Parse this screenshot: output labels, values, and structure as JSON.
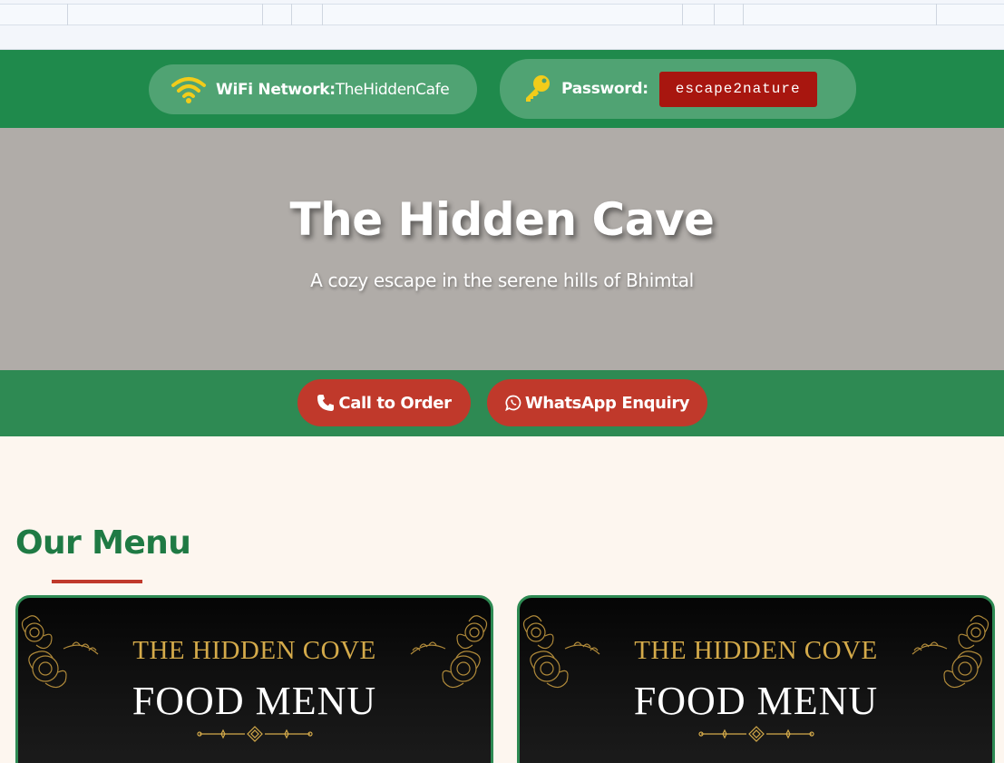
{
  "wifi": {
    "network_label": "WiFi Network:",
    "network_value": "TheHiddenCafe",
    "password_label": "Password:",
    "password_value": "escape2nature"
  },
  "hero": {
    "title": "The Hidden Cave",
    "subtitle": "A cozy escape in the serene hills of Bhimtal"
  },
  "actions": {
    "call_label": "Call to Order",
    "whatsapp_label": "WhatsApp Enquiry"
  },
  "menu": {
    "heading": "Our Menu",
    "cards": [
      {
        "brand": "THE HIDDEN COVE",
        "name": "FOOD MENU"
      },
      {
        "brand": "THE HIDDEN COVE",
        "name": "FOOD MENU"
      }
    ]
  },
  "colors": {
    "wifi_bar": "#1f8a4c",
    "hero_bg": "#b0aca8",
    "action_bar": "#2e8a53",
    "button_red": "#c0392b",
    "password_box": "#a8160f",
    "menu_heading": "#1f7a44",
    "gold": "#d4aa4a",
    "page_bg": "#fdf6ef"
  }
}
